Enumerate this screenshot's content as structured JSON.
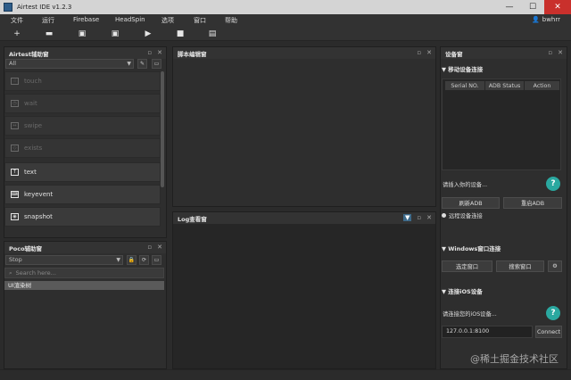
{
  "window": {
    "title": "Airtest IDE v1.2.3"
  },
  "menu": {
    "items": [
      "文件",
      "运行",
      "Firebase",
      "HeadSpin",
      "选项",
      "窗口",
      "帮助"
    ],
    "user": "bwhrr"
  },
  "toolbar": {
    "icons": [
      "plus-icon",
      "folder-icon",
      "save-icon",
      "save-as-icon",
      "play-icon",
      "stop-icon",
      "report-icon"
    ]
  },
  "airtest_panel": {
    "title": "Airtest辅助窗",
    "filter_value": "All",
    "commands": [
      {
        "label": "touch",
        "enabled": false,
        "icon": "touch-icon"
      },
      {
        "label": "wait",
        "enabled": false,
        "icon": "wait-icon"
      },
      {
        "label": "swipe",
        "enabled": false,
        "icon": "swipe-icon"
      },
      {
        "label": "exists",
        "enabled": false,
        "icon": "exists-icon"
      },
      {
        "label": "text",
        "enabled": true,
        "icon": "text-icon"
      },
      {
        "label": "keyevent",
        "enabled": true,
        "icon": "keyboard-icon"
      },
      {
        "label": "snapshot",
        "enabled": true,
        "icon": "camera-icon"
      }
    ]
  },
  "poco_panel": {
    "title": "Poco辅助窗",
    "mode_value": "Stop",
    "search_placeholder": "Search here...",
    "tree_root": "UI渲染树"
  },
  "editor_panel": {
    "title": "脚本编辑窗"
  },
  "log_panel": {
    "title": "Log查看窗"
  },
  "device_panel": {
    "title": "设备窗",
    "mobile_section": "▼ 移动设备连接",
    "columns": [
      "Serial NO.",
      "ADB Status",
      "Action"
    ],
    "input_prompt": "请插入你的设备...",
    "refresh_adb": "刷新ADB",
    "restart_adb": "重启ADB",
    "remote_connect": "远程设备连接",
    "windows_section": "▼ Windows窗口连接",
    "select_window": "选定窗口",
    "search_window": "搜索窗口",
    "ios_section": "▼ 连接iOS设备",
    "ios_prompt": "请连接您的iOS设备...",
    "ios_address": "127.0.0.1:8100",
    "connect": "Connect",
    "help_glyph": "?"
  },
  "watermark": "@稀土掘金技术社区"
}
